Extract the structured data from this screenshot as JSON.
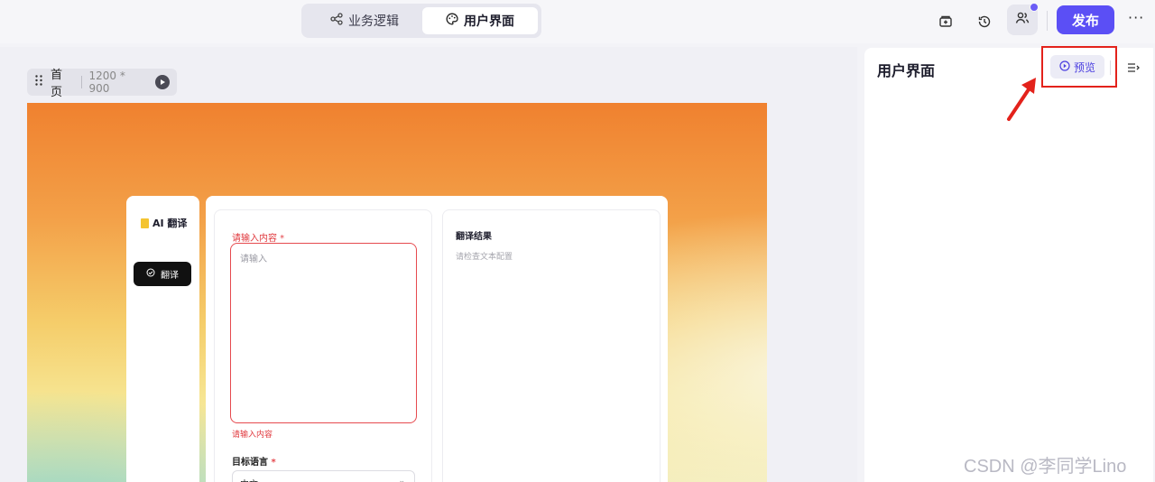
{
  "header": {
    "tabs": [
      {
        "label": "业务逻辑",
        "active": false
      },
      {
        "label": "用户界面",
        "active": true
      }
    ],
    "publish_label": "发布",
    "more_label": "···"
  },
  "canvas": {
    "page_name": "首页",
    "page_size": "1200 * 900",
    "app": {
      "brand": "AI 翻译",
      "nav_button": "翻译",
      "input_label": "请输入内容",
      "input_placeholder": "请输入",
      "input_error": "请输入内容",
      "lang_label": "目标语言",
      "lang_value": "中文",
      "result_title": "翻译结果",
      "result_hint": "请检查文本配置"
    }
  },
  "panel": {
    "title": "用户界面",
    "preview_label": "预览"
  },
  "annotation": {
    "highlight_color": "#e3221b"
  },
  "watermark": "CSDN @李同学Lino",
  "colors": {
    "accent": "#5b4ff5",
    "error": "#e0393e"
  }
}
